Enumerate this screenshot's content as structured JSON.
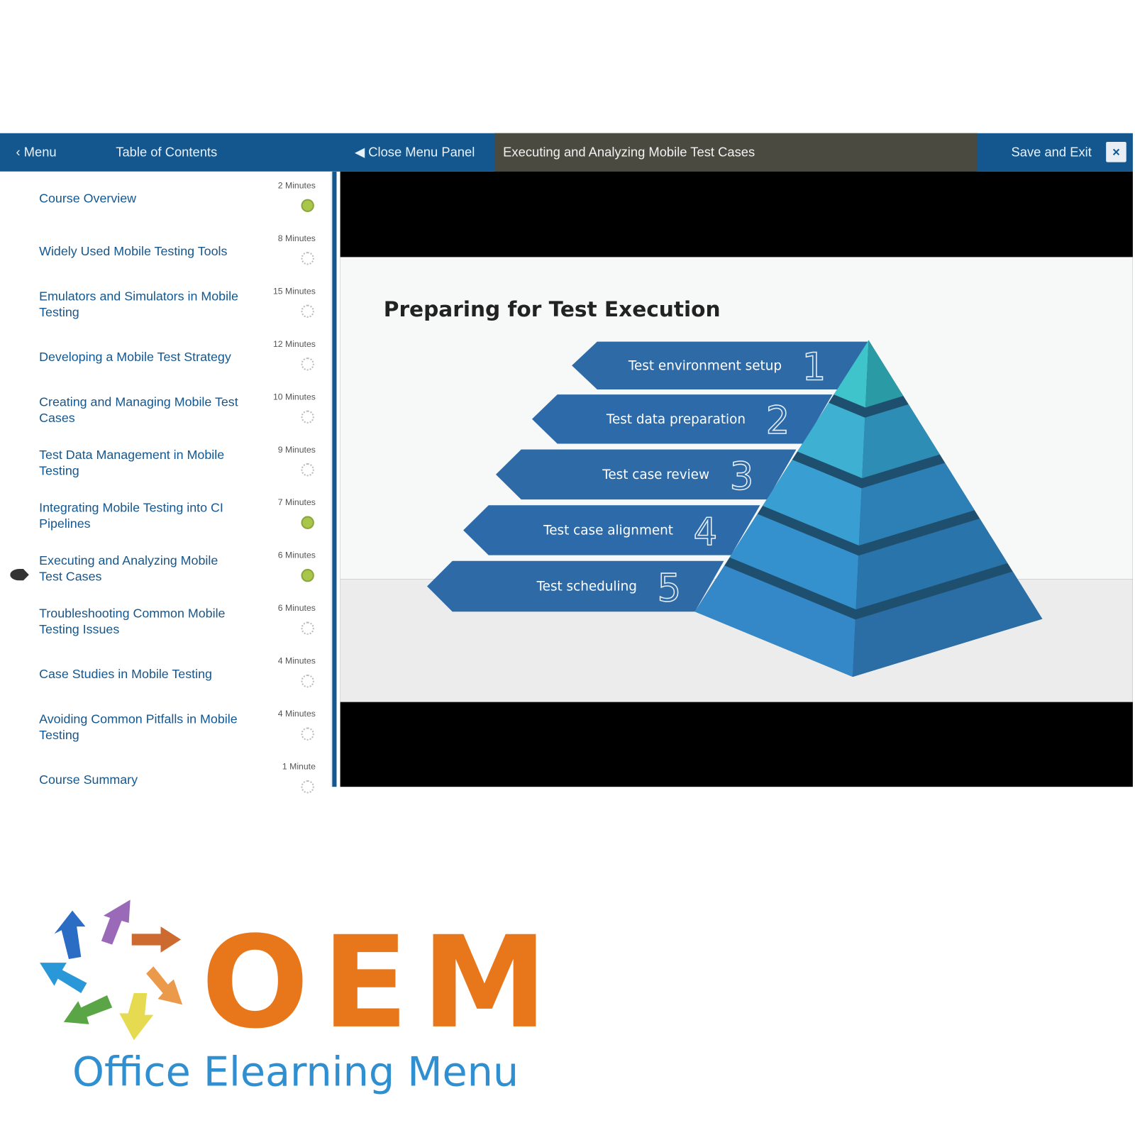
{
  "header": {
    "menu_label": "Menu",
    "toc_label": "Table of Contents",
    "close_panel_label": "Close Menu Panel",
    "lesson_title": "Executing and Analyzing Mobile Test Cases",
    "save_exit_label": "Save and Exit",
    "close_icon": "×"
  },
  "sidebar": {
    "items": [
      {
        "title": "Course Overview",
        "duration": "2 Minutes",
        "status": "complete"
      },
      {
        "title": "Widely Used Mobile Testing Tools",
        "duration": "8 Minutes",
        "status": "incomplete"
      },
      {
        "title": "Emulators and Simulators in Mobile Testing",
        "duration": "15 Minutes",
        "status": "incomplete"
      },
      {
        "title": "Developing a Mobile Test Strategy",
        "duration": "12 Minutes",
        "status": "incomplete"
      },
      {
        "title": "Creating and Managing Mobile Test Cases",
        "duration": "10 Minutes",
        "status": "incomplete"
      },
      {
        "title": "Test Data Management in Mobile Testing",
        "duration": "9 Minutes",
        "status": "incomplete"
      },
      {
        "title": "Integrating Mobile Testing into CI Pipelines",
        "duration": "7 Minutes",
        "status": "complete"
      },
      {
        "title": "Executing and Analyzing Mobile Test Cases",
        "duration": "6 Minutes",
        "status": "complete",
        "current": true
      },
      {
        "title": "Troubleshooting Common Mobile Testing Issues",
        "duration": "6 Minutes",
        "status": "incomplete"
      },
      {
        "title": "Case Studies in Mobile Testing",
        "duration": "4 Minutes",
        "status": "incomplete"
      },
      {
        "title": "Avoiding Common Pitfalls in Mobile Testing",
        "duration": "4 Minutes",
        "status": "incomplete"
      },
      {
        "title": "Course Summary",
        "duration": "1 Minute",
        "status": "incomplete"
      }
    ]
  },
  "slide": {
    "title": "Preparing for Test Execution",
    "steps": [
      {
        "label": "Test environment setup",
        "number": "1"
      },
      {
        "label": "Test data preparation",
        "number": "2"
      },
      {
        "label": "Test case review",
        "number": "3"
      },
      {
        "label": "Test case alignment",
        "number": "4"
      },
      {
        "label": "Test scheduling",
        "number": "5"
      }
    ]
  },
  "logo": {
    "text": "OEM",
    "tagline": "Office Elearning Menu"
  },
  "colors": {
    "header": "#14578f",
    "title_bar": "#4a4a40",
    "complete": "#a9c64a",
    "logo_orange": "#e8761a",
    "logo_blue": "#2f8fd0"
  }
}
